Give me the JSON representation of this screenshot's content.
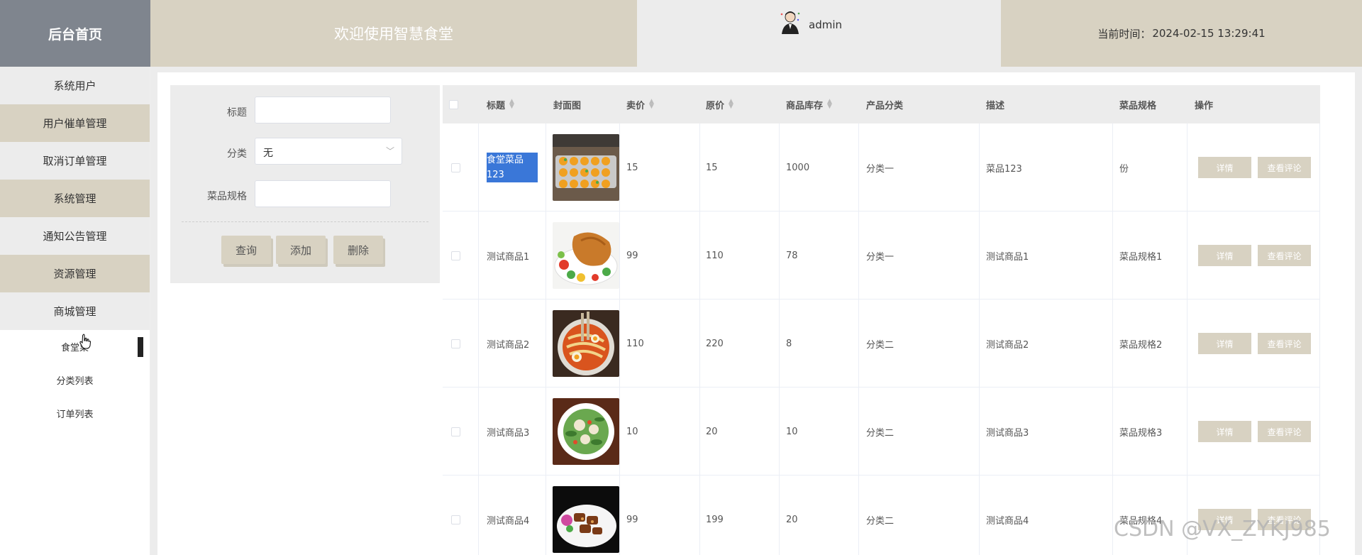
{
  "header": {
    "brand": "后台首页",
    "welcome": "欢迎使用智慧食堂",
    "username": "admin",
    "time_label": "当前时间：",
    "time_value": "2024-02-15 13:29:41"
  },
  "sidebar": {
    "items": [
      {
        "label": "系统用户"
      },
      {
        "label": "用户催单管理"
      },
      {
        "label": "取消订单管理"
      },
      {
        "label": "系统管理"
      },
      {
        "label": "通知公告管理"
      },
      {
        "label": "资源管理"
      },
      {
        "label": "商城管理"
      }
    ],
    "subitems": [
      {
        "label": "食堂菜"
      },
      {
        "label": "分类列表"
      },
      {
        "label": "订单列表"
      }
    ]
  },
  "search": {
    "title_label": "标题",
    "category_label": "分类",
    "category_value": "无",
    "spec_label": "菜品规格",
    "query_btn": "查询",
    "add_btn": "添加",
    "delete_btn": "删除"
  },
  "table": {
    "headers": {
      "title": "标题",
      "cover": "封面图",
      "price": "卖价",
      "orig_price": "原价",
      "stock": "商品库存",
      "category": "产品分类",
      "desc": "描述",
      "spec": "菜品规格",
      "action": "操作"
    },
    "detail_btn": "详情",
    "review_btn": "查看评论",
    "rows": [
      {
        "title": "食堂菜品123",
        "price": "15",
        "orig": "15",
        "stock": "1000",
        "category": "分类一",
        "desc": "菜品123",
        "spec": "份"
      },
      {
        "title": "测试商品1",
        "price": "99",
        "orig": "110",
        "stock": "78",
        "category": "分类一",
        "desc": "测试商品1",
        "spec": "菜品规格1"
      },
      {
        "title": "测试商品2",
        "price": "110",
        "orig": "220",
        "stock": "8",
        "category": "分类二",
        "desc": "测试商品2",
        "spec": "菜品规格2"
      },
      {
        "title": "测试商品3",
        "price": "10",
        "orig": "20",
        "stock": "10",
        "category": "分类二",
        "desc": "测试商品3",
        "spec": "菜品规格3"
      },
      {
        "title": "测试商品4",
        "price": "99",
        "orig": "199",
        "stock": "20",
        "category": "分类二",
        "desc": "测试商品4",
        "spec": "菜品规格4"
      }
    ]
  },
  "watermark": "CSDN @VX_ZYKJ985",
  "colors": {
    "accent": "#d8d2c2",
    "brand_bg": "#7f858e",
    "base_gray": "#ececec",
    "highlight": "#3a77d8"
  }
}
